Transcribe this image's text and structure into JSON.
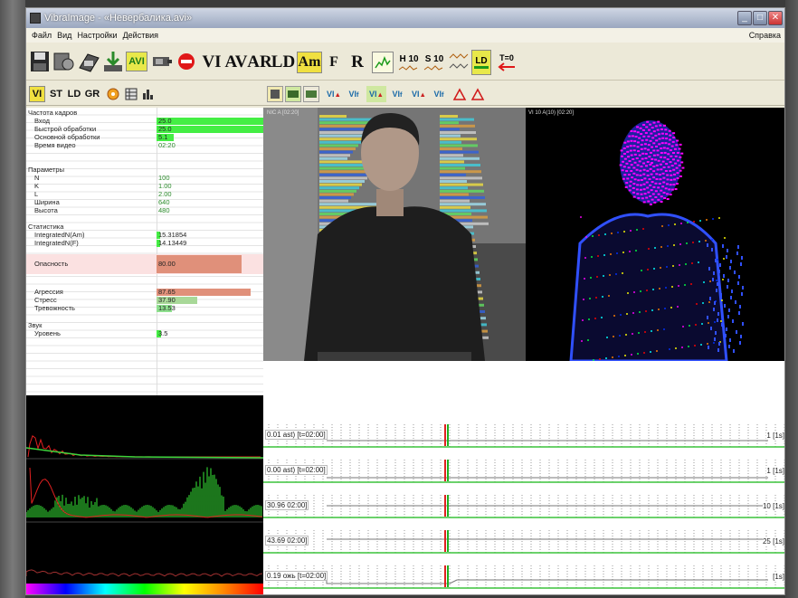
{
  "window": {
    "title": "VibraImage - «Невербалика.avi»"
  },
  "menu": {
    "file": "Файл",
    "view": "Вид",
    "settings": "Настройки",
    "actions": "Действия",
    "help": "Справка"
  },
  "toolbar": {
    "avi": "AVI",
    "vi": "VI",
    "av": "AV",
    "ar": "AR",
    "ld": "LD",
    "am": "Am",
    "f": "F",
    "r": "R",
    "h10": "H 10",
    "s10": "S 10",
    "ld2": "LD",
    "t0": "T=0"
  },
  "toolbar2": {
    "vi": "VI",
    "st": "ST",
    "ld": "LD",
    "gr": "GR"
  },
  "params": {
    "sec_frames": "Частота кадров",
    "rows_frames": [
      {
        "label": "Вход",
        "value": "25.0",
        "pct": 100,
        "color": "#44ee44"
      },
      {
        "label": "Быстрой обработки",
        "value": "25.0",
        "pct": 100,
        "color": "#44ee44"
      },
      {
        "label": "Основной обработки",
        "value": "5.1",
        "pct": 16,
        "color": "#44ee44"
      },
      {
        "label": "Время видео",
        "value": "02:20",
        "pct": 0,
        "color": "#44ee44"
      }
    ],
    "sec_params": "Параметры",
    "rows_params": [
      {
        "label": "N",
        "value": "100"
      },
      {
        "label": "K",
        "value": "1.00"
      },
      {
        "label": "L",
        "value": "2.00"
      },
      {
        "label": "Ширина",
        "value": "640"
      },
      {
        "label": "Высота",
        "value": "480"
      }
    ],
    "sec_stats": "Статистика",
    "rows_stats": [
      {
        "label": "IntegratedN(Am)",
        "value": "15.31854",
        "pct": 3,
        "color": "#44ee44"
      },
      {
        "label": "IntegratedN(F)",
        "value": "14.13449",
        "pct": 3,
        "color": "#44ee44"
      }
    ],
    "danger": {
      "label": "Опасность",
      "value": "80.00",
      "pct": 80
    },
    "rows_emotion": [
      {
        "label": "Агрессия",
        "value": "87.65",
        "pct": 88,
        "color": "#e0907a"
      },
      {
        "label": "Стресс",
        "value": "37.90",
        "pct": 38,
        "color": "#a8d898"
      },
      {
        "label": "Тревожность",
        "value": "13.53",
        "pct": 14,
        "color": "#8ee08e"
      }
    ],
    "sec_sound": "Звук",
    "sound": {
      "label": "Уровень",
      "value": "3.5",
      "pct": 4
    }
  },
  "video": {
    "left_label": "NIC A [02:20]",
    "right_label": "VI 10 A(10) [02:20]"
  },
  "tracks": [
    {
      "label": "0.01 ast) [t=02:00]",
      "right": "1 [1s]"
    },
    {
      "label": "0.00 ast) [t=02:00]",
      "right": "1 [1s]"
    },
    {
      "label": "30.96 02:00]",
      "right": "10 [1s]"
    },
    {
      "label": "43.69 02:00]",
      "right": "25 [1s]"
    },
    {
      "label": "0.19 ожь [t=02:00]",
      "right": "[1s]"
    }
  ]
}
